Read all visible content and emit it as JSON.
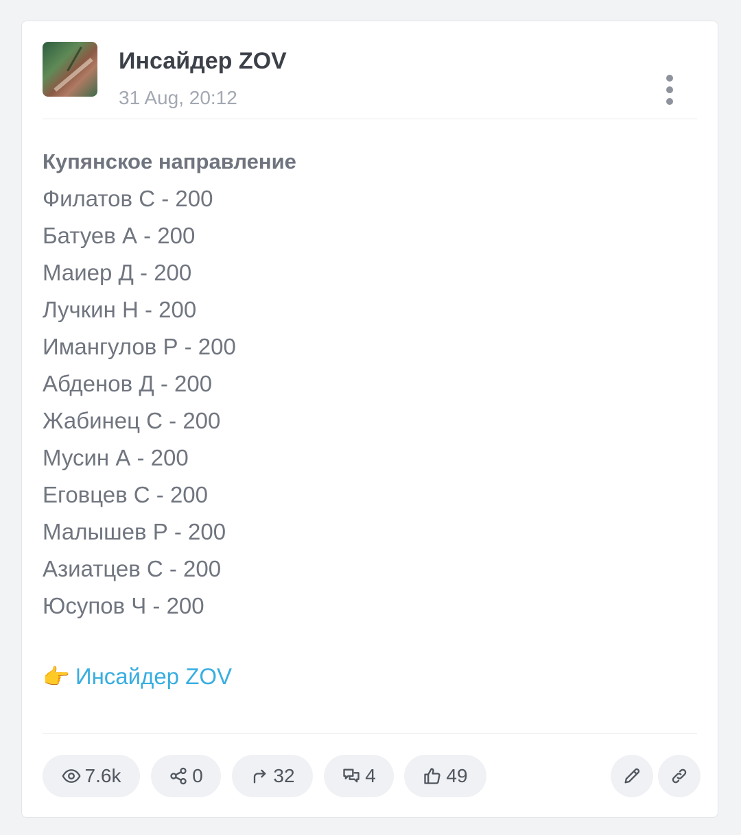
{
  "post": {
    "channel_name": "Инсайдер ZOV",
    "time": "31 Aug, 20:12",
    "avatar_icon": "channel-avatar-image",
    "more_icon": "more-vertical-icon",
    "section_title": "Купянское направление",
    "lines": [
      "Филатов С - 200",
      "Батуев А - 200",
      "Маиер Д - 200",
      "Лучкин Н - 200",
      "Имангулов Р - 200",
      "Абденов Д - 200",
      "Жабинец С - 200",
      "Мусин А - 200",
      "Еговцев С - 200",
      "Малышев Р - 200",
      "Азиатцев С - 200",
      "Юсупов Ч - 200"
    ],
    "signature_emoji": "👉",
    "signature_link": "Инсайдер ZOV",
    "link_color": "#38aee0"
  },
  "stats": {
    "views": "7.6k",
    "shares": "0",
    "forwards": "32",
    "comments": "4",
    "reactions": "49"
  },
  "actions": {
    "edit_icon": "pencil-icon",
    "link_icon": "link-icon"
  }
}
